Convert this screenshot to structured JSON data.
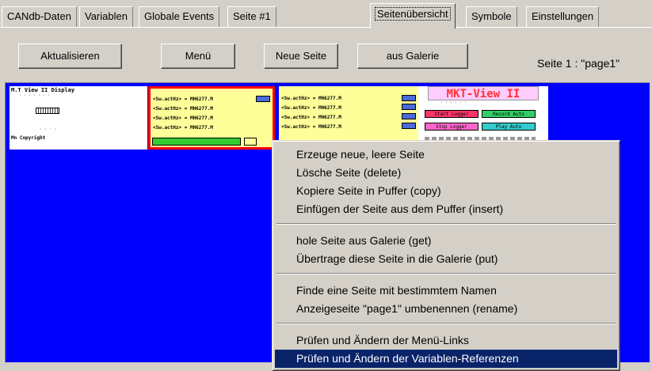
{
  "tabs": [
    {
      "label": "CANdb-Daten"
    },
    {
      "label": "Variablen"
    },
    {
      "label": "Globale Events"
    },
    {
      "label": "Seite #1"
    },
    {
      "label": "Seitenübersicht"
    },
    {
      "label": "Symbole"
    },
    {
      "label": "Einstellungen"
    }
  ],
  "toolbar": {
    "refresh_label": "Aktualisieren",
    "menu_label": "Menü",
    "new_page_label": "Neue Seite",
    "gallery_label": "aus Galerie",
    "page_label": "Seite 1 : \"page1\""
  },
  "thumbnails": {
    "t1_title": "M.T View II Display",
    "t1_copy": "Mn Copyright",
    "t2_lines": [
      "<Sw.actHz> = MH6277.M",
      "<Sw.actHz> = MH6277.M",
      "<Sw.actHz> = MH6277.M",
      "<Sw.actHz> = MH6277.M"
    ],
    "t3_lines": [
      "<Sw.actHz> = MH6277.M",
      "<Sw.actHz> = MH6277.M",
      "<Sw.actHz> = MH6277.M",
      "<Sw.actHz> = MH6277.M"
    ],
    "t4_title": "MKT-View II",
    "t4_buttons": [
      "Start Logger",
      "Record Auto",
      "Stop Logger",
      "Play Auto"
    ]
  },
  "context_menu": {
    "group1": [
      "Erzeuge neue, leere Seite",
      "Lösche Seite (delete)",
      "Kopiere Seite in Puffer (copy)",
      "Einfügen der Seite aus dem Puffer (insert)"
    ],
    "group2": [
      "hole Seite aus Galerie (get)",
      "Übertrage diese Seite in die Galerie (put)"
    ],
    "group3": [
      "Finde eine Seite mit bestimmtem Namen",
      "Anzeigeseite \"page1\" umbenennen (rename)"
    ],
    "group4": [
      "Prüfen und Ändern der Menü-Links",
      "Prüfen und Ändern der Variablen-Referenzen"
    ],
    "selected": "Prüfen und Ändern der Variablen-Referenzen"
  },
  "colors": {
    "page_background": "#0000ff",
    "selection": "#0a246a",
    "window_face": "#d4d0c8"
  }
}
